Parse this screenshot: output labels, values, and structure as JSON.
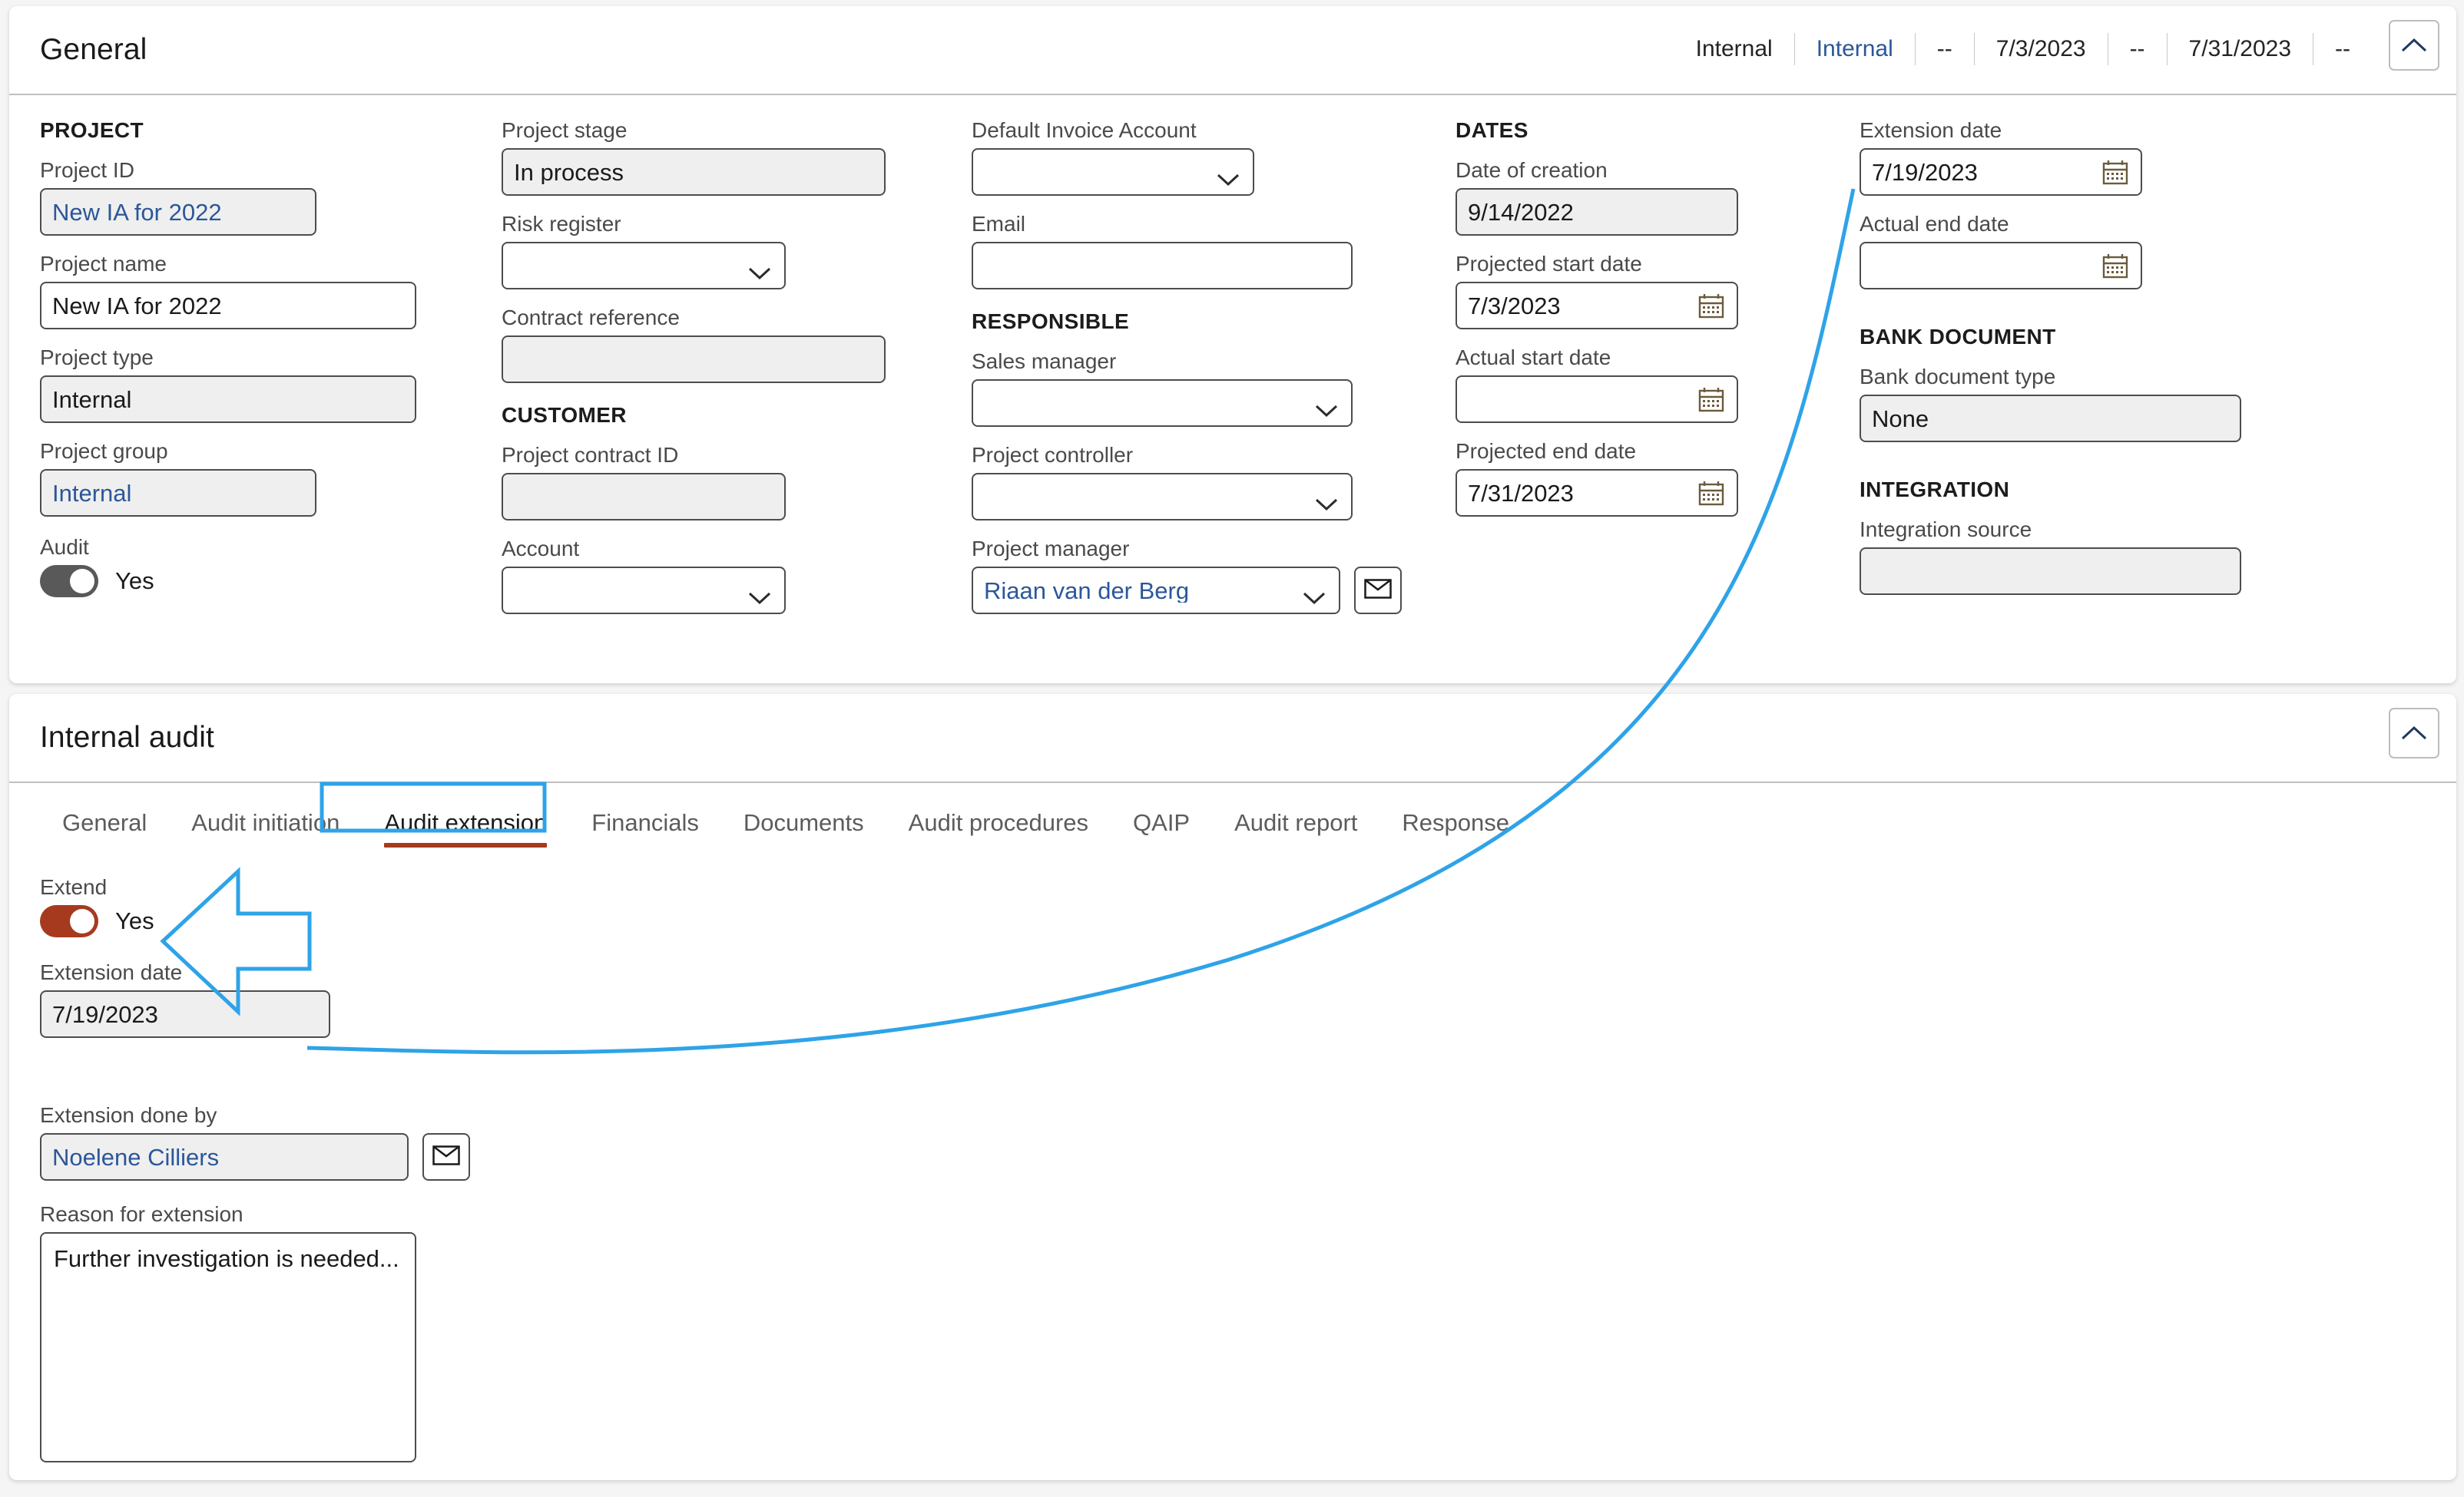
{
  "general": {
    "title": "General",
    "summary": [
      "Internal",
      "Internal",
      "--",
      "7/3/2023",
      "--",
      "7/31/2023",
      "--"
    ],
    "collapse_icon": "chevron-up-icon",
    "project": {
      "group_title": "PROJECT",
      "project_id_label": "Project ID",
      "project_id_value": "New IA for 2022",
      "project_name_label": "Project name",
      "project_name_value": "New IA for 2022",
      "project_type_label": "Project type",
      "project_type_value": "Internal",
      "project_group_label": "Project group",
      "project_group_value": "Internal",
      "audit_label": "Audit",
      "audit_toggle_value": "Yes"
    },
    "stage": {
      "project_stage_label": "Project stage",
      "project_stage_value": "In process",
      "risk_register_label": "Risk register",
      "risk_register_value": "",
      "contract_reference_label": "Contract reference",
      "contract_reference_value": ""
    },
    "customer": {
      "group_title": "CUSTOMER",
      "project_contract_id_label": "Project contract ID",
      "project_contract_id_value": "",
      "account_label": "Account",
      "account_value": ""
    },
    "invoice": {
      "default_invoice_account_label": "Default Invoice Account",
      "default_invoice_account_value": "",
      "email_label": "Email",
      "email_value": ""
    },
    "responsible": {
      "group_title": "RESPONSIBLE",
      "sales_manager_label": "Sales manager",
      "sales_manager_value": "",
      "project_controller_label": "Project controller",
      "project_controller_value": "",
      "project_manager_label": "Project manager",
      "project_manager_value": "Riaan van der Berg",
      "email_button_icon": "envelope-icon"
    },
    "dates": {
      "group_title": "DATES",
      "date_of_creation_label": "Date of creation",
      "date_of_creation_value": "9/14/2022",
      "projected_start_date_label": "Projected start date",
      "projected_start_date_value": "7/3/2023",
      "actual_start_date_label": "Actual start date",
      "actual_start_date_value": "",
      "projected_end_date_label": "Projected end date",
      "projected_end_date_value": "7/31/2023"
    },
    "extension": {
      "extension_date_label": "Extension date",
      "extension_date_value": "7/19/2023",
      "actual_end_date_label": "Actual end date",
      "actual_end_date_value": ""
    },
    "bank_document": {
      "group_title": "BANK DOCUMENT",
      "bank_document_type_label": "Bank document type",
      "bank_document_type_value": "None"
    },
    "integration": {
      "group_title": "INTEGRATION",
      "integration_source_label": "Integration source",
      "integration_source_value": ""
    }
  },
  "internal_audit": {
    "title": "Internal audit",
    "collapse_icon": "chevron-up-icon",
    "tabs": [
      {
        "label": "General",
        "active": false
      },
      {
        "label": "Audit initiation",
        "active": false
      },
      {
        "label": "Audit extension",
        "active": true
      },
      {
        "label": "Financials",
        "active": false
      },
      {
        "label": "Documents",
        "active": false
      },
      {
        "label": "Audit procedures",
        "active": false
      },
      {
        "label": "QAIP",
        "active": false
      },
      {
        "label": "Audit report",
        "active": false
      },
      {
        "label": "Response",
        "active": false
      }
    ],
    "extend_label": "Extend",
    "extend_toggle_value": "Yes",
    "extension_date_label": "Extension date",
    "extension_date_value": "7/19/2023",
    "extension_done_by_label": "Extension done by",
    "extension_done_by_value": "Noelene Cilliers",
    "extension_done_by_email_icon": "envelope-icon",
    "reason_label": "Reason for extension",
    "reason_value": "Further investigation is needed..."
  },
  "colors": {
    "accent_link": "#2b579a",
    "toggle_on_rust": "#a63a1f",
    "toggle_on_gray": "#595959",
    "annotation_blue": "#2ea3e8",
    "tab_underline": "#a63a1f"
  },
  "annotations": {
    "highlight_target": "Audit extension",
    "arrow_points_to": "Extend toggle",
    "connector_links": "Extension date fields"
  }
}
